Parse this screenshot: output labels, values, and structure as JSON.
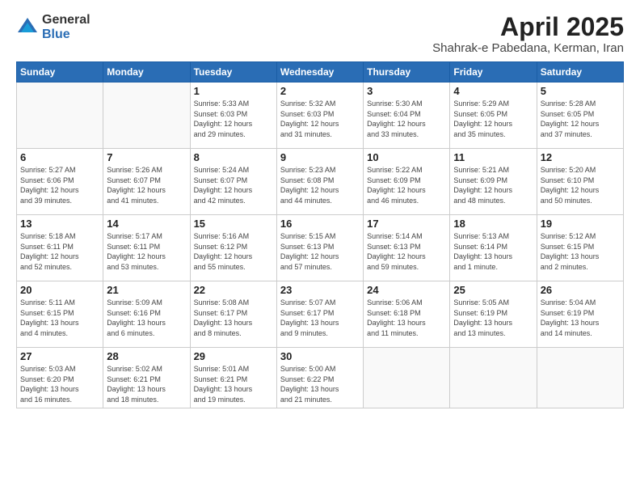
{
  "logo": {
    "general": "General",
    "blue": "Blue"
  },
  "title": "April 2025",
  "subtitle": "Shahrak-e Pabedana, Kerman, Iran",
  "headers": [
    "Sunday",
    "Monday",
    "Tuesday",
    "Wednesday",
    "Thursday",
    "Friday",
    "Saturday"
  ],
  "weeks": [
    [
      {
        "day": "",
        "detail": ""
      },
      {
        "day": "",
        "detail": ""
      },
      {
        "day": "1",
        "detail": "Sunrise: 5:33 AM\nSunset: 6:03 PM\nDaylight: 12 hours\nand 29 minutes."
      },
      {
        "day": "2",
        "detail": "Sunrise: 5:32 AM\nSunset: 6:03 PM\nDaylight: 12 hours\nand 31 minutes."
      },
      {
        "day": "3",
        "detail": "Sunrise: 5:30 AM\nSunset: 6:04 PM\nDaylight: 12 hours\nand 33 minutes."
      },
      {
        "day": "4",
        "detail": "Sunrise: 5:29 AM\nSunset: 6:05 PM\nDaylight: 12 hours\nand 35 minutes."
      },
      {
        "day": "5",
        "detail": "Sunrise: 5:28 AM\nSunset: 6:05 PM\nDaylight: 12 hours\nand 37 minutes."
      }
    ],
    [
      {
        "day": "6",
        "detail": "Sunrise: 5:27 AM\nSunset: 6:06 PM\nDaylight: 12 hours\nand 39 minutes."
      },
      {
        "day": "7",
        "detail": "Sunrise: 5:26 AM\nSunset: 6:07 PM\nDaylight: 12 hours\nand 41 minutes."
      },
      {
        "day": "8",
        "detail": "Sunrise: 5:24 AM\nSunset: 6:07 PM\nDaylight: 12 hours\nand 42 minutes."
      },
      {
        "day": "9",
        "detail": "Sunrise: 5:23 AM\nSunset: 6:08 PM\nDaylight: 12 hours\nand 44 minutes."
      },
      {
        "day": "10",
        "detail": "Sunrise: 5:22 AM\nSunset: 6:09 PM\nDaylight: 12 hours\nand 46 minutes."
      },
      {
        "day": "11",
        "detail": "Sunrise: 5:21 AM\nSunset: 6:09 PM\nDaylight: 12 hours\nand 48 minutes."
      },
      {
        "day": "12",
        "detail": "Sunrise: 5:20 AM\nSunset: 6:10 PM\nDaylight: 12 hours\nand 50 minutes."
      }
    ],
    [
      {
        "day": "13",
        "detail": "Sunrise: 5:18 AM\nSunset: 6:11 PM\nDaylight: 12 hours\nand 52 minutes."
      },
      {
        "day": "14",
        "detail": "Sunrise: 5:17 AM\nSunset: 6:11 PM\nDaylight: 12 hours\nand 53 minutes."
      },
      {
        "day": "15",
        "detail": "Sunrise: 5:16 AM\nSunset: 6:12 PM\nDaylight: 12 hours\nand 55 minutes."
      },
      {
        "day": "16",
        "detail": "Sunrise: 5:15 AM\nSunset: 6:13 PM\nDaylight: 12 hours\nand 57 minutes."
      },
      {
        "day": "17",
        "detail": "Sunrise: 5:14 AM\nSunset: 6:13 PM\nDaylight: 12 hours\nand 59 minutes."
      },
      {
        "day": "18",
        "detail": "Sunrise: 5:13 AM\nSunset: 6:14 PM\nDaylight: 13 hours\nand 1 minute."
      },
      {
        "day": "19",
        "detail": "Sunrise: 5:12 AM\nSunset: 6:15 PM\nDaylight: 13 hours\nand 2 minutes."
      }
    ],
    [
      {
        "day": "20",
        "detail": "Sunrise: 5:11 AM\nSunset: 6:15 PM\nDaylight: 13 hours\nand 4 minutes."
      },
      {
        "day": "21",
        "detail": "Sunrise: 5:09 AM\nSunset: 6:16 PM\nDaylight: 13 hours\nand 6 minutes."
      },
      {
        "day": "22",
        "detail": "Sunrise: 5:08 AM\nSunset: 6:17 PM\nDaylight: 13 hours\nand 8 minutes."
      },
      {
        "day": "23",
        "detail": "Sunrise: 5:07 AM\nSunset: 6:17 PM\nDaylight: 13 hours\nand 9 minutes."
      },
      {
        "day": "24",
        "detail": "Sunrise: 5:06 AM\nSunset: 6:18 PM\nDaylight: 13 hours\nand 11 minutes."
      },
      {
        "day": "25",
        "detail": "Sunrise: 5:05 AM\nSunset: 6:19 PM\nDaylight: 13 hours\nand 13 minutes."
      },
      {
        "day": "26",
        "detail": "Sunrise: 5:04 AM\nSunset: 6:19 PM\nDaylight: 13 hours\nand 14 minutes."
      }
    ],
    [
      {
        "day": "27",
        "detail": "Sunrise: 5:03 AM\nSunset: 6:20 PM\nDaylight: 13 hours\nand 16 minutes."
      },
      {
        "day": "28",
        "detail": "Sunrise: 5:02 AM\nSunset: 6:21 PM\nDaylight: 13 hours\nand 18 minutes."
      },
      {
        "day": "29",
        "detail": "Sunrise: 5:01 AM\nSunset: 6:21 PM\nDaylight: 13 hours\nand 19 minutes."
      },
      {
        "day": "30",
        "detail": "Sunrise: 5:00 AM\nSunset: 6:22 PM\nDaylight: 13 hours\nand 21 minutes."
      },
      {
        "day": "",
        "detail": ""
      },
      {
        "day": "",
        "detail": ""
      },
      {
        "day": "",
        "detail": ""
      }
    ]
  ]
}
